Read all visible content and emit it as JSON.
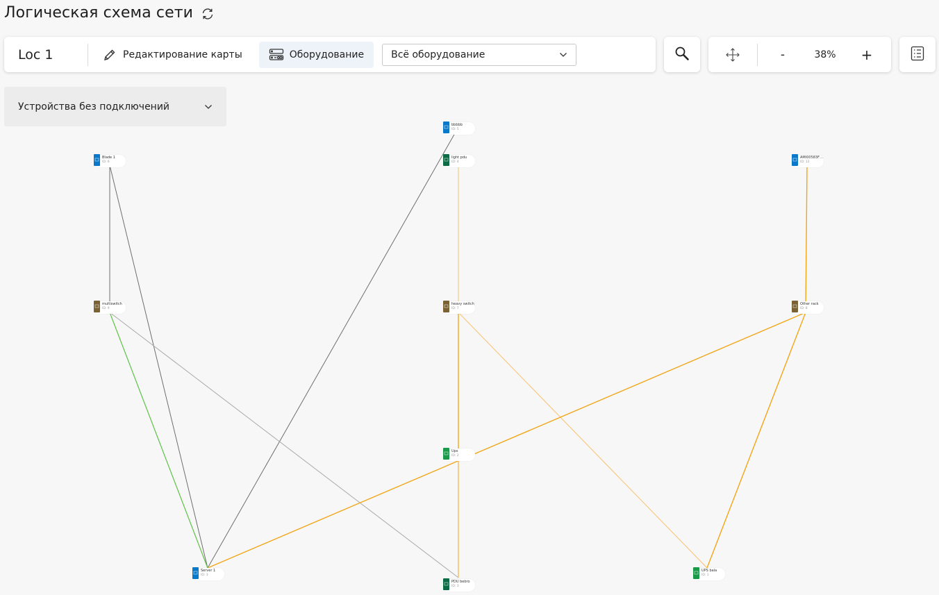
{
  "title": "Логическая схема сети",
  "toolbar": {
    "location": "Loc 1",
    "edit_map": "Редактирование карты",
    "equipment": "Оборудование",
    "filter_value": "Всё оборудование"
  },
  "zoom": {
    "minus": "-",
    "value": "38%",
    "plus": "+"
  },
  "unconnected": {
    "label": "Устройства без подключений"
  },
  "colors": {
    "blue": "#0a78c8",
    "brown": "#7a6235",
    "green": "#1a9a48",
    "teal": "#0a6b45",
    "link_gray": "#6e6e6e",
    "link_lightgray": "#a9a9a9",
    "link_green": "#5ec146",
    "link_orange": "#f2a617",
    "link_lightorange": "#f8c57a"
  },
  "nodes": [
    {
      "key": "bbbbb",
      "name": "bbbbb",
      "id": "ID: 5",
      "color": "blue",
      "icon": "server-icon"
    },
    {
      "key": "blade1",
      "name": "Blade 1",
      "id": "ID: 6",
      "color": "blue",
      "icon": "server-icon"
    },
    {
      "key": "lightpdu",
      "name": "light pdu",
      "id": "ID: 4",
      "color": "teal",
      "icon": "pdu-icon"
    },
    {
      "key": "ami",
      "name": "AMI00583F…",
      "id": "ID: 12",
      "color": "blue",
      "icon": "server-icon"
    },
    {
      "key": "multiswitch",
      "name": "multiswitch",
      "id": "ID: 9",
      "color": "brown",
      "icon": "rack-icon"
    },
    {
      "key": "heavyswitch",
      "name": "heavy switch",
      "id": "ID: 7",
      "color": "brown",
      "icon": "rack-icon"
    },
    {
      "key": "otherrack",
      "name": "Other rack",
      "id": "ID: 8",
      "color": "brown",
      "icon": "rack-icon"
    },
    {
      "key": "ups",
      "name": "Ups",
      "id": "ID: 2",
      "color": "green",
      "icon": "ups-icon"
    },
    {
      "key": "server1",
      "name": "Server 1",
      "id": "ID: 3",
      "color": "blue",
      "icon": "server-icon"
    },
    {
      "key": "pdubebro",
      "name": "PDU bebro",
      "id": "ID: 3",
      "color": "teal",
      "icon": "pdu-icon"
    },
    {
      "key": "upsbala",
      "name": "UPS bala",
      "id": "ID: 1",
      "color": "green",
      "icon": "ups-icon"
    }
  ],
  "links": [
    {
      "from": "blade1",
      "to": "multiswitch",
      "color": "link_gray"
    },
    {
      "from": "blade1",
      "to": "server1",
      "color": "link_gray"
    },
    {
      "from": "bbbbb",
      "to": "server1",
      "color": "link_gray"
    },
    {
      "from": "multiswitch",
      "to": "server1",
      "color": "link_green"
    },
    {
      "from": "multiswitch",
      "to": "pdubebro",
      "color": "link_lightgray"
    },
    {
      "from": "lightpdu",
      "to": "heavyswitch",
      "color": "link_lightorange"
    },
    {
      "from": "heavyswitch",
      "to": "pdubebro",
      "color": "link_orange"
    },
    {
      "from": "heavyswitch",
      "to": "upsbala",
      "color": "link_lightorange"
    },
    {
      "from": "ups",
      "to": "pdubebro",
      "color": "link_lightorange"
    },
    {
      "from": "ami",
      "to": "otherrack",
      "color": "link_orange"
    },
    {
      "from": "otherrack",
      "to": "upsbala",
      "color": "link_orange"
    },
    {
      "from": "otherrack",
      "to": "server1",
      "color": "link_orange"
    }
  ]
}
